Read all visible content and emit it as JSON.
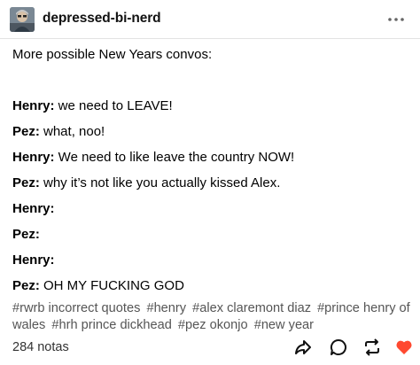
{
  "post": {
    "blog_name": "depressed-bi-nerd",
    "menu_icon": "more-horizontal-icon",
    "intro": "More possible New Years convos:",
    "dialogue": [
      {
        "speaker": "Henry:",
        "text": " we need to LEAVE!"
      },
      {
        "speaker": "Pez:",
        "text": " what, noo!"
      },
      {
        "speaker": "Henry:",
        "text": " We need to like leave the country NOW!"
      },
      {
        "speaker": "Pez:",
        "text": " why it’s not like you actually kissed Alex."
      },
      {
        "speaker": "Henry:",
        "text": ""
      },
      {
        "speaker": "Pez:",
        "text": ""
      },
      {
        "speaker": "Henry:",
        "text": ""
      },
      {
        "speaker": "Pez:",
        "text": " OH MY FUCKING GOD"
      }
    ],
    "tags": [
      "#rwrb incorrect quotes",
      "#henry",
      "#alex claremont diaz",
      "#prince henry of wales",
      "#hrh prince dickhead",
      "#pez okonjo",
      "#new year"
    ],
    "notes_label": "284 notas"
  },
  "actions": {
    "share_icon": "share-icon",
    "reply_icon": "reply-icon",
    "reblog_icon": "reblog-icon",
    "like_icon": "heart-icon"
  },
  "colors": {
    "like": "#ff4930",
    "text": "#000000",
    "tags": "#555555",
    "divider": "#e3e3e3"
  }
}
